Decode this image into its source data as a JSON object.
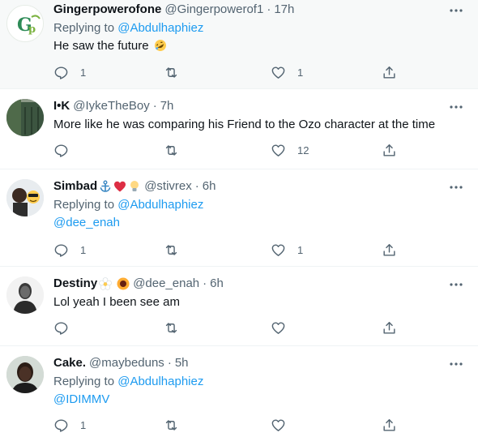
{
  "tweets": [
    {
      "name": "Gingerpowerofone",
      "handle": "@Gingerpowerof1",
      "time": "17h",
      "reply_prefix": "Replying to",
      "reply_to": "@Abdulhaphiez",
      "text": "He saw the future",
      "replies": "1",
      "retweets": "",
      "likes": "1"
    },
    {
      "name": "I•K",
      "handle": "@IykeTheBoy",
      "time": "7h",
      "text": "More like he was comparing his Friend to the Ozo character at the time",
      "replies": "",
      "retweets": "",
      "likes": "12"
    },
    {
      "name": "Simbad",
      "handle": "@stivrex",
      "time": "6h",
      "reply_prefix": "Replying to",
      "reply_to": "@Abdulhaphiez",
      "mention": "@dee_enah",
      "replies": "1",
      "retweets": "",
      "likes": "1"
    },
    {
      "name": "Destiny",
      "handle": "@dee_enah",
      "time": "6h",
      "text": "Lol yeah I been see am",
      "replies": "",
      "retweets": "",
      "likes": ""
    },
    {
      "name": "Cake.",
      "handle": "@maybeduns",
      "time": "5h",
      "reply_prefix": "Replying to",
      "reply_to": "@Abdulhaphiez",
      "mention": "@IDIMMV",
      "replies": "1",
      "retweets": "",
      "likes": ""
    }
  ],
  "separator": "·",
  "icons": [
    "reply-icon",
    "retweet-icon",
    "like-icon",
    "share-icon",
    "more-icon"
  ],
  "colors": {
    "link": "#1d9bf0",
    "muted": "#536471",
    "text": "#0f1419",
    "highlight_bg": "#f7f9f9"
  }
}
